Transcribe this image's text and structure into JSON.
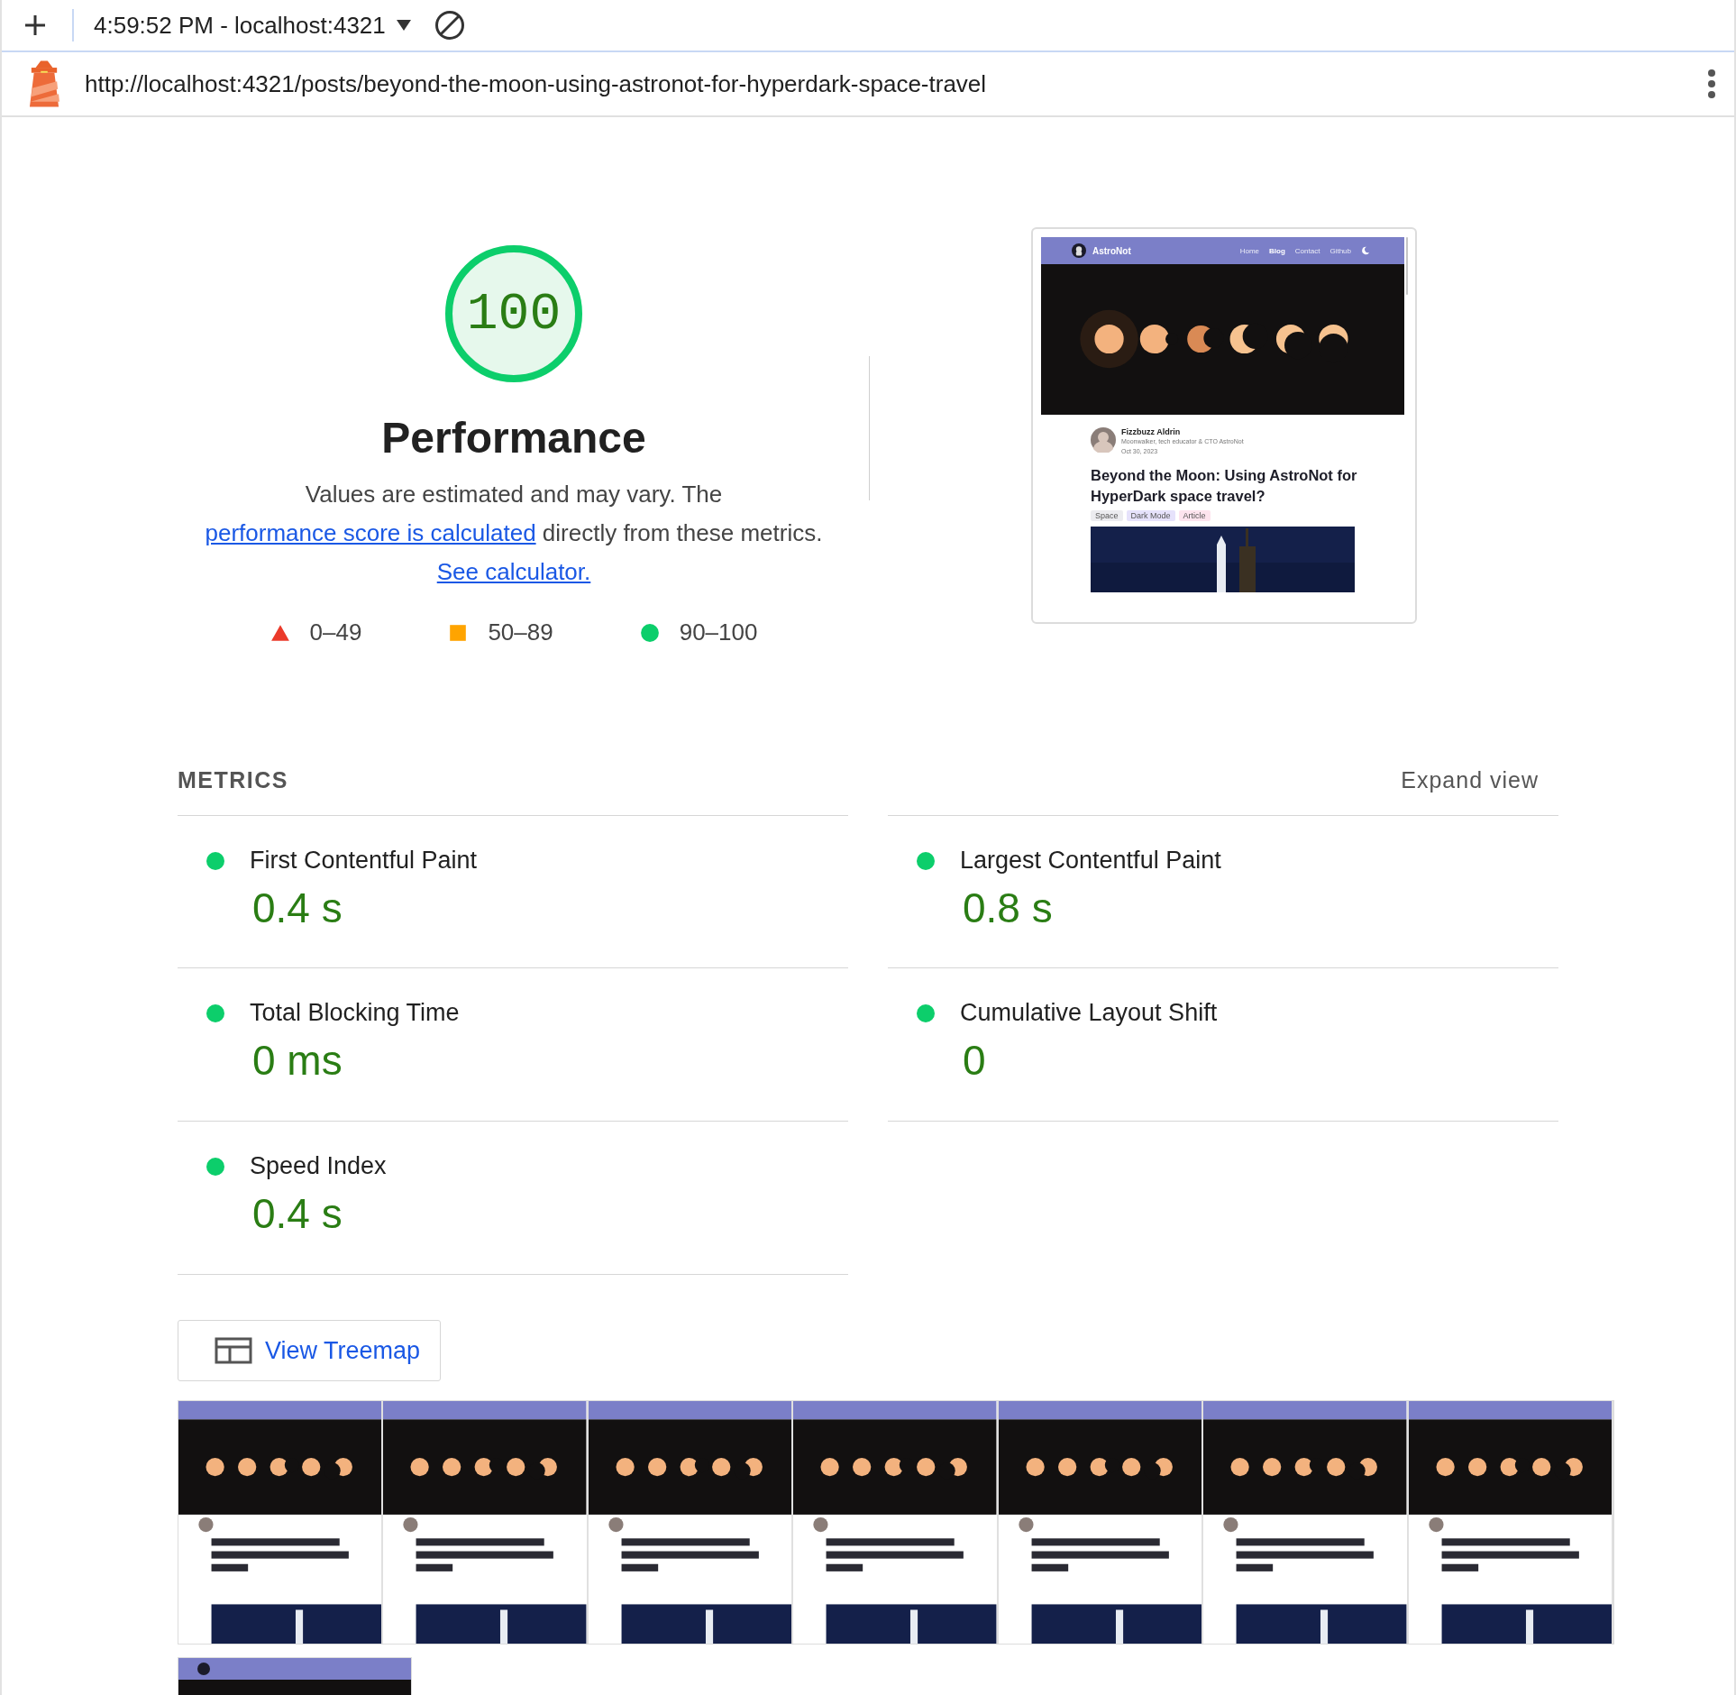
{
  "toolbar": {
    "report_label": "4:59:52 PM - localhost:4321"
  },
  "url_bar": {
    "url": "http://localhost:4321/posts/beyond-the-moon-using-astronot-for-hyperdark-space-travel"
  },
  "score": {
    "value": "100",
    "level": 1,
    "kind": "pass",
    "title": "Performance",
    "description": [
      {
        "text": "Values are estimated and may vary. The ",
        "link": false
      },
      {
        "text": "performance score is calculated",
        "link": true
      },
      {
        "text": " directly from these metrics. ",
        "link": false
      },
      {
        "text": "See calculator.",
        "link": true
      }
    ],
    "legend": [
      {
        "range": "0–49",
        "kind": "fail"
      },
      {
        "range": "50–89",
        "kind": "average"
      },
      {
        "range": "90–100",
        "kind": "pass"
      }
    ]
  },
  "preview": {
    "site_name": "AstroNot",
    "nav": [
      {
        "label": "Home",
        "selected": false
      },
      {
        "label": "Blog",
        "selected": true
      },
      {
        "label": "Contact",
        "selected": false
      },
      {
        "label": "Github",
        "selected": false
      }
    ],
    "author": {
      "name": "Fizzbuzz Aldrin",
      "bio": "Moonwalker, tech educator & CTO AstroNot",
      "date": "Oct 30, 2023"
    },
    "title": "Beyond the Moon: Using AstroNot for HyperDark space travel?",
    "tags": [
      {
        "label": "Space",
        "color": "#ececf0"
      },
      {
        "label": "Dark Mode",
        "color": "#e6e2fb"
      },
      {
        "label": "Article",
        "color": "#fde4ee"
      }
    ]
  },
  "metrics": {
    "title": "METRICS",
    "toggle": "Expand view",
    "items": [
      {
        "name": "First Contentful Paint",
        "value": "0.4 s",
        "kind": "pass"
      },
      {
        "name": "Largest Contentful Paint",
        "value": "0.8 s",
        "kind": "pass"
      },
      {
        "name": "Total Blocking Time",
        "value": "0 ms",
        "kind": "pass"
      },
      {
        "name": "Cumulative Layout Shift",
        "value": "0",
        "kind": "pass"
      },
      {
        "name": "Speed Index",
        "value": "0.4 s",
        "kind": "pass"
      }
    ]
  },
  "treemap_button": {
    "label": "View Treemap"
  }
}
